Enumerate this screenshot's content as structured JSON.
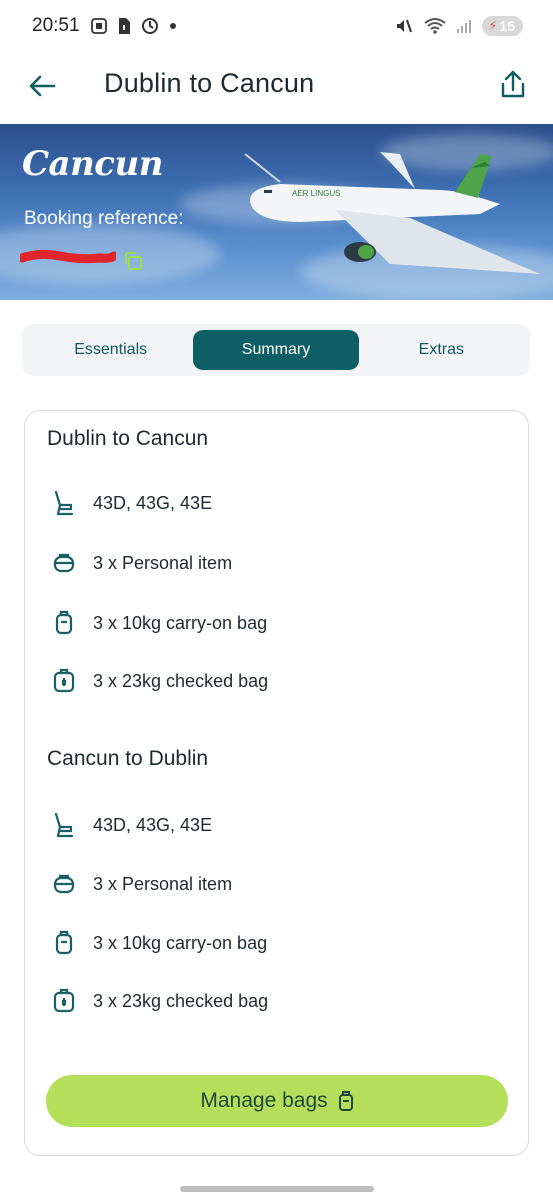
{
  "status_bar": {
    "time": "20:51",
    "battery": "15"
  },
  "header": {
    "title": "Dublin to Cancun",
    "back_icon": "arrow-left-icon",
    "share_icon": "share-icon"
  },
  "hero": {
    "destination": "Cancun",
    "booking_reference_label": "Booking reference:",
    "booking_reference_value": "(redacted)"
  },
  "tabs": [
    {
      "label": "Essentials",
      "active": false
    },
    {
      "label": "Summary",
      "active": true
    },
    {
      "label": "Extras",
      "active": false
    }
  ],
  "outbound": {
    "title": "Dublin to Cancun",
    "seats": "43D, 43G, 43E",
    "personal_item": "3 x Personal item",
    "carry_on": "3 x 10kg carry-on bag",
    "checked": "3 x 23kg checked bag"
  },
  "return": {
    "title": "Cancun to Dublin",
    "seats": "43D, 43G, 43E",
    "personal_item": "3 x Personal item",
    "carry_on": "3 x 10kg carry-on bag",
    "checked": "3 x 23kg checked bag"
  },
  "actions": {
    "manage_bags": "Manage bags"
  },
  "colors": {
    "brand_teal": "#0e5e66",
    "accent_green": "#b5df5a",
    "icon_teal": "#1b5f66"
  }
}
